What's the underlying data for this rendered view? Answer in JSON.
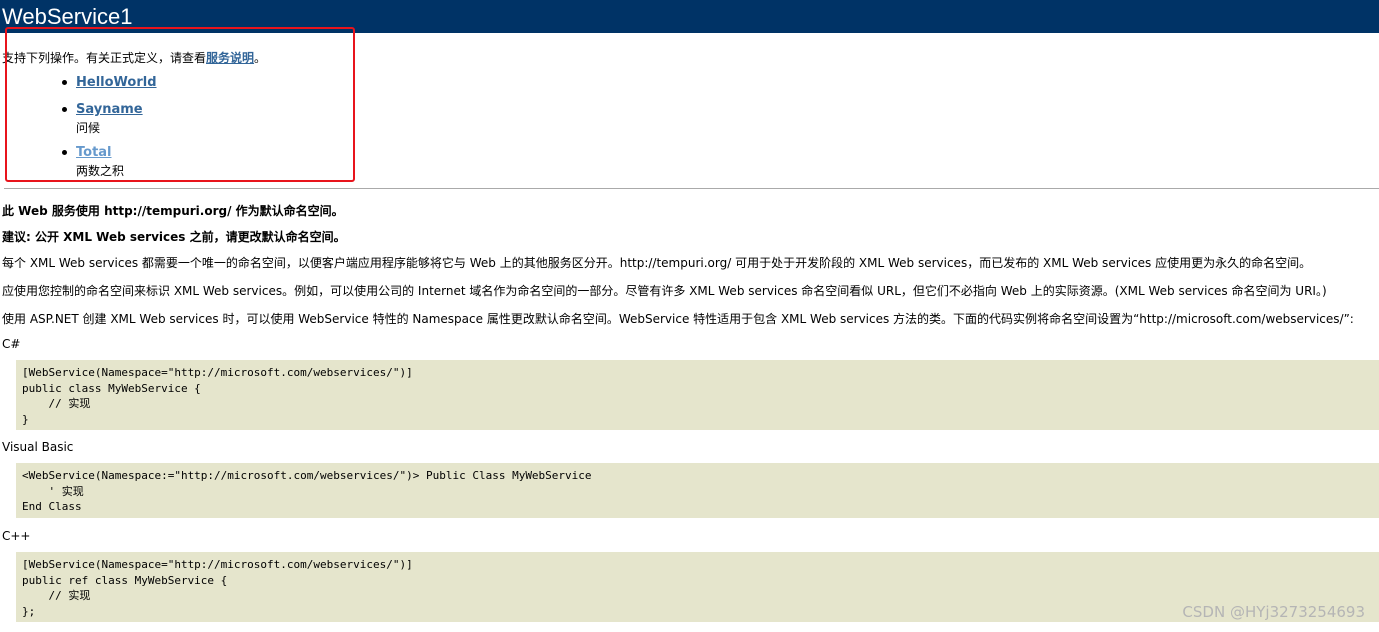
{
  "header": {
    "title": "WebService1"
  },
  "intro": {
    "text": "支持下列操作。有关正式定义，请查看",
    "link": "服务说明",
    "suffix": "。"
  },
  "operations": [
    {
      "name": "HelloWorld",
      "description": ""
    },
    {
      "name": "Sayname",
      "description": "问候"
    },
    {
      "name": "Total",
      "description": "两数之积"
    }
  ],
  "namespace_notice": {
    "line1": "此 Web 服务使用 http://tempuri.org/ 作为默认命名空间。",
    "line2": "建议: 公开 XML Web services 之前，请更改默认命名空间。",
    "para1": "每个 XML Web services 都需要一个唯一的命名空间，以便客户端应用程序能够将它与 Web 上的其他服务区分开。http://tempuri.org/ 可用于处于开发阶段的 XML Web services，而已发布的 XML Web services 应使用更为永久的命名空间。",
    "para2": "应使用您控制的命名空间来标识 XML Web services。例如，可以使用公司的 Internet 域名作为命名空间的一部分。尽管有许多 XML Web services 命名空间看似 URL，但它们不必指向 Web 上的实际资源。(XML Web services 命名空间为 URI。)",
    "para3": "使用 ASP.NET 创建 XML Web services 时，可以使用 WebService 特性的 Namespace 属性更改默认命名空间。WebService 特性适用于包含 XML Web services 方法的类。下面的代码实例将命名空间设置为“http://microsoft.com/webservices/”:"
  },
  "code_samples": [
    {
      "language": "C#",
      "code": "[WebService(Namespace=\"http://microsoft.com/webservices/\")]\npublic class MyWebService {\n    // 实现\n}"
    },
    {
      "language": "Visual Basic",
      "code": "<WebService(Namespace:=\"http://microsoft.com/webservices/\")> Public Class MyWebService\n    ' 实现\nEnd Class"
    },
    {
      "language": "C++",
      "code": "[WebService(Namespace=\"http://microsoft.com/webservices/\")]\npublic ref class MyWebService {\n    // 实现\n};"
    }
  ],
  "watermark": "CSDN @HYj3273254693"
}
